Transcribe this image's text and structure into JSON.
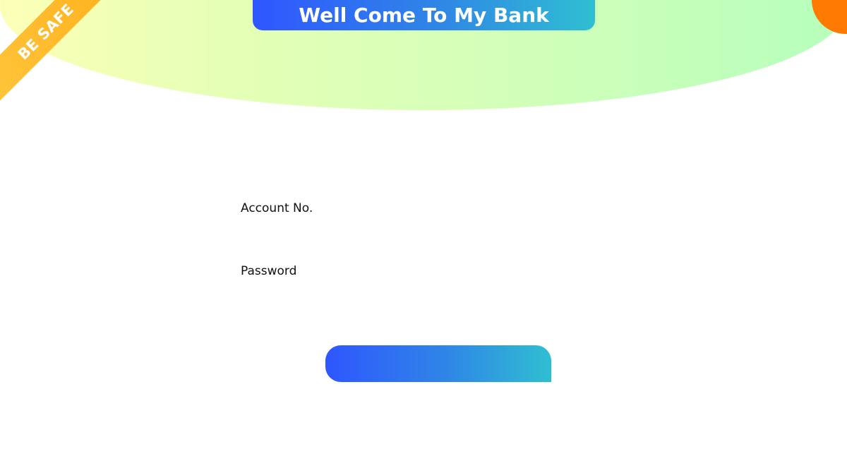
{
  "ribbon": {
    "text": "BE SAFE"
  },
  "header": {
    "title": "Well Come To My Bank"
  },
  "form": {
    "account_label": "Account No.",
    "account_value": "",
    "account_placeholder": "",
    "password_label": "Password",
    "password_value": "",
    "password_placeholder": "",
    "submit_label": ""
  },
  "colors": {
    "accent_start": "#2f56ff",
    "accent_end": "#2fbfd1",
    "ribbon": "#ffbc2a",
    "orange_dot": "#ff7a00",
    "hero_start": "#fdffb7",
    "hero_end": "#b6ffbc"
  }
}
